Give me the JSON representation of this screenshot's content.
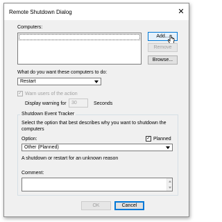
{
  "window": {
    "title": "Remote Shutdown Dialog",
    "close_glyph": "✕"
  },
  "computers": {
    "label": "Computers:",
    "add_label": "Add...",
    "remove_label": "Remove",
    "browse_label": "Browse..."
  },
  "action": {
    "label": "What do you want these computers to do:",
    "selected": "Restart"
  },
  "warn": {
    "label": "Warn users of the action",
    "display_label": "Display warning for",
    "seconds_value": "30",
    "seconds_unit": "Seconds"
  },
  "tracker": {
    "legend": "Shutdown Event Tracker",
    "description": "Select the option that best describes why you want to shutdown the computers",
    "option_label": "Option:",
    "planned_label": "Planned",
    "planned_checked": true,
    "option_selected": "Other (Planned)",
    "option_description": "A shutdown or restart for an unknown reason",
    "comment_label": "Comment:"
  },
  "footer": {
    "ok_label": "OK",
    "cancel_label": "Cancel"
  }
}
